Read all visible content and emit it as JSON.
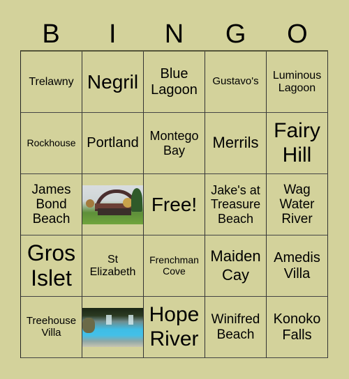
{
  "header": [
    "B",
    "I",
    "N",
    "G",
    "O"
  ],
  "colors": {
    "background": "#d3d29b",
    "grid_line": "#333333",
    "text": "#000000"
  },
  "cells": [
    {
      "text": "Trelawny"
    },
    {
      "text": "Negril"
    },
    {
      "text": "Blue Lagoon"
    },
    {
      "text": "Gustavo's"
    },
    {
      "text": "Luminous Lagoon"
    },
    {
      "text": "Rockhouse"
    },
    {
      "text": "Portland"
    },
    {
      "text": "Montego Bay"
    },
    {
      "text": "Merrils"
    },
    {
      "text": "Fairy Hill"
    },
    {
      "text": "James Bond Beach"
    },
    {
      "image": "appleton-estate-photo"
    },
    {
      "text": "Free!"
    },
    {
      "text": "Jake's at Treasure Beach"
    },
    {
      "text": "Wag Water River"
    },
    {
      "text": "Gros Islet"
    },
    {
      "text": "St Elizabeth"
    },
    {
      "text": "Frenchman Cove"
    },
    {
      "text": "Maiden Cay"
    },
    {
      "text": "Amedis Villa"
    },
    {
      "text": "Treehouse Villa"
    },
    {
      "image": "waterfall-photo"
    },
    {
      "text": "Hope River"
    },
    {
      "text": "Winifred Beach"
    },
    {
      "text": "Konoko Falls"
    }
  ]
}
